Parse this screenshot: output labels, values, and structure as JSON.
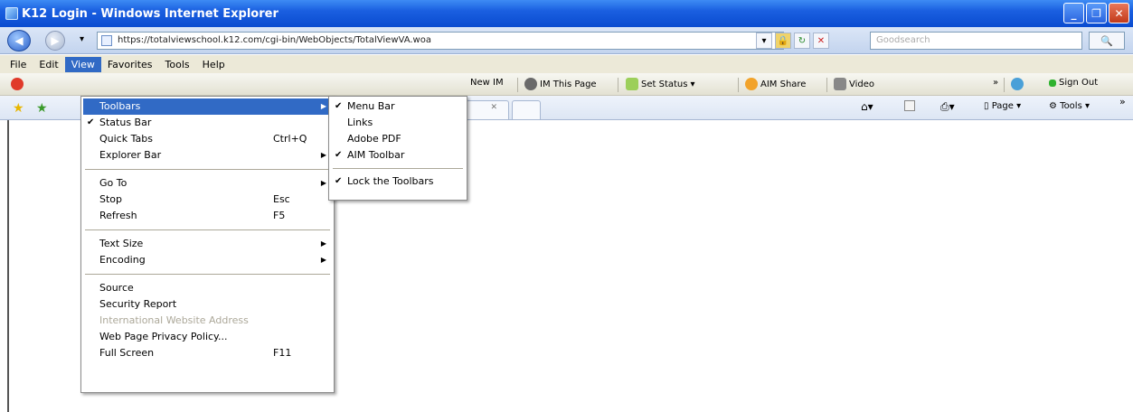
{
  "window": {
    "title": "K12 Login - Windows Internet Explorer",
    "minimize": "_",
    "maximize": "❐",
    "close": "✕"
  },
  "address_bar": {
    "url": "https://totalviewschool.k12.com/cgi-bin/WebObjects/TotalViewVA.woa",
    "back": "◀",
    "forward": "▶",
    "dropdown": "▾",
    "refresh": "↻",
    "stop": "✕",
    "search_placeholder": "Goodsearch",
    "search_button": "🔍"
  },
  "menubar": {
    "items": [
      "File",
      "Edit",
      "View",
      "Favorites",
      "Tools",
      "Help"
    ]
  },
  "aim_toolbar": {
    "new_im": "New IM",
    "im_this_page": "IM This Page",
    "set_status": "Set Status",
    "aim_share": "AIM Share",
    "video": "Video",
    "sign_out": "Sign Out",
    "overflow": "»"
  },
  "command_bar": {
    "page": "Page",
    "tools": "Tools",
    "overflow": "»"
  },
  "view_menu": {
    "items": [
      {
        "label": "Toolbars",
        "check": "",
        "shortcut": "",
        "arrow": "▶"
      },
      {
        "label": "Status Bar",
        "check": "✔",
        "shortcut": "",
        "arrow": ""
      },
      {
        "label": "Quick Tabs",
        "check": "",
        "shortcut": "Ctrl+Q",
        "arrow": ""
      },
      {
        "label": "Explorer Bar",
        "check": "",
        "shortcut": "",
        "arrow": "▶"
      },
      {
        "label": "Go To",
        "check": "",
        "shortcut": "",
        "arrow": "▶"
      },
      {
        "label": "Stop",
        "check": "",
        "shortcut": "Esc",
        "arrow": ""
      },
      {
        "label": "Refresh",
        "check": "",
        "shortcut": "F5",
        "arrow": ""
      },
      {
        "label": "Text Size",
        "check": "",
        "shortcut": "",
        "arrow": "▶"
      },
      {
        "label": "Encoding",
        "check": "",
        "shortcut": "",
        "arrow": "▶"
      },
      {
        "label": "Source",
        "check": "",
        "shortcut": "",
        "arrow": ""
      },
      {
        "label": "Security Report",
        "check": "",
        "shortcut": "",
        "arrow": ""
      },
      {
        "label": "International Website Address",
        "check": "",
        "shortcut": "",
        "arrow": ""
      },
      {
        "label": "Web Page Privacy Policy...",
        "check": "",
        "shortcut": "",
        "arrow": ""
      },
      {
        "label": "Full Screen",
        "check": "",
        "shortcut": "F11",
        "arrow": ""
      }
    ]
  },
  "toolbars_submenu": {
    "items": [
      {
        "label": "Menu Bar",
        "check": "✔"
      },
      {
        "label": "Links",
        "check": ""
      },
      {
        "label": "Adobe PDF",
        "check": ""
      },
      {
        "label": "AIM Toolbar",
        "check": "✔"
      },
      {
        "label": "Lock the Toolbars",
        "check": "✔"
      }
    ]
  }
}
